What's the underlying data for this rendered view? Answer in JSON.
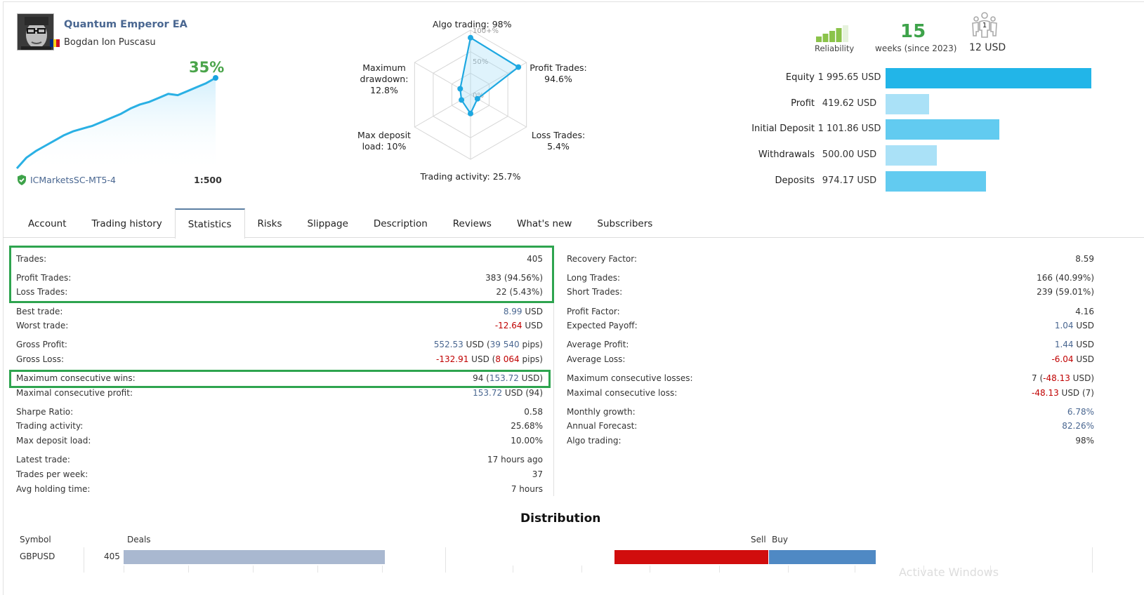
{
  "profile": {
    "signal_name": "Quantum Emperor EA",
    "author": "Bogdan Ion Puscasu",
    "flag_colors": [
      "#002B7F",
      "#FCD116",
      "#CE1126"
    ],
    "growth": "35%",
    "broker": "ICMarketsSC-MT5-4",
    "leverage": "1:500",
    "growth_curve": [
      0,
      8,
      13,
      17,
      21,
      25,
      28,
      30,
      32,
      35,
      38,
      41,
      45,
      48,
      50,
      53,
      56,
      55,
      58,
      61,
      64,
      68
    ]
  },
  "radar": {
    "axes": [
      {
        "label": "Algo trading: 98%",
        "value": 98
      },
      {
        "label": "Profit Trades:\n94.6%",
        "value": 94.6
      },
      {
        "label": "Loss Trades:\n5.4%",
        "value": 5.4
      },
      {
        "label": "Trading activity: 25.7%",
        "value": 25.7
      },
      {
        "label": "Max deposit\nload: 10%",
        "value": 10
      },
      {
        "label": "Maximum\ndrawdown:\n12.8%",
        "value": 12.8
      }
    ],
    "ring_labels": [
      "100+%",
      "50%",
      "0%"
    ]
  },
  "summary": {
    "reliability_label": "Reliability",
    "reliability_level": 4,
    "reliability_max": 5,
    "weeks": "15",
    "weeks_label": "weeks (since 2023)",
    "subscribers_count": "1",
    "price": "12 USD"
  },
  "financials": [
    {
      "label": "Equity",
      "value": "1 995.65 USD",
      "amount": 1995.65,
      "color": "#22b5e8"
    },
    {
      "label": "Profit",
      "value": "419.62 USD",
      "amount": 419.62,
      "color": "#aae1f7"
    },
    {
      "label": "Initial Deposit",
      "value": "1 101.86 USD",
      "amount": 1101.86,
      "color": "#62cbf0"
    },
    {
      "label": "Withdrawals",
      "value": "500.00 USD",
      "amount": 500.0,
      "color": "#aae1f7"
    },
    {
      "label": "Deposits",
      "value": "974.17 USD",
      "amount": 974.17,
      "color": "#62cbf0"
    }
  ],
  "tabs": [
    {
      "label": "Account",
      "active": false
    },
    {
      "label": "Trading history",
      "active": false
    },
    {
      "label": "Statistics",
      "active": true
    },
    {
      "label": "Risks",
      "active": false
    },
    {
      "label": "Slippage",
      "active": false
    },
    {
      "label": "Description",
      "active": false
    },
    {
      "label": "Reviews",
      "active": false
    },
    {
      "label": "What's new",
      "active": false
    },
    {
      "label": "Subscribers",
      "active": false
    }
  ],
  "stats_left": [
    {
      "label": "Trades:",
      "value": "405"
    },
    {
      "label": "Profit Trades:",
      "value": "383 (94.56%)"
    },
    {
      "label": "Loss Trades:",
      "value": "22 (5.43%)"
    },
    {
      "label": "Best trade:",
      "value_num": "8.99",
      "value_unit": " USD",
      "tone": "blue"
    },
    {
      "label": "Worst trade:",
      "value_num": "-12.64",
      "value_unit": " USD",
      "tone": "red"
    },
    {
      "label": "Gross Profit:",
      "value_num": "552.53",
      "value_unit": " USD (",
      "value_num2": "39 540",
      "value_unit2": " pips)",
      "tone": "blue"
    },
    {
      "label": "Gross Loss:",
      "value_num": "-132.91",
      "value_unit": " USD (",
      "value_num2": "8 064",
      "value_unit2": " pips)",
      "tone": "red"
    },
    {
      "label": "Maximum consecutive wins:",
      "value_pre": "94 (",
      "value_num": "153.72",
      "value_unit": " USD)",
      "tone": "blue"
    },
    {
      "label": "Maximal consecutive profit:",
      "value_num": "153.72",
      "value_unit": " USD (94)",
      "tone": "blue"
    },
    {
      "label": "Sharpe Ratio:",
      "value": "0.58"
    },
    {
      "label": "Trading activity:",
      "value": "25.68%"
    },
    {
      "label": "Max deposit load:",
      "value": "10.00%"
    },
    {
      "label": "Latest trade:",
      "value": "17 hours ago"
    },
    {
      "label": "Trades per week:",
      "value": "37"
    },
    {
      "label": "Avg holding time:",
      "value": "7 hours"
    }
  ],
  "stats_right": [
    {
      "label": "Recovery Factor:",
      "value": "8.59"
    },
    {
      "label": "Long Trades:",
      "value": "166 (40.99%)"
    },
    {
      "label": "Short Trades:",
      "value": "239 (59.01%)"
    },
    {
      "label": "Profit Factor:",
      "value": "4.16"
    },
    {
      "label": "Expected Payoff:",
      "value_num": "1.04",
      "value_unit": " USD",
      "tone": "blue"
    },
    {
      "label": "Average Profit:",
      "value_num": "1.44",
      "value_unit": " USD",
      "tone": "blue"
    },
    {
      "label": "Average Loss:",
      "value_num": "-6.04",
      "value_unit": " USD",
      "tone": "red"
    },
    {
      "label": "Maximum consecutive losses:",
      "value_pre": "7 (",
      "value_num": "-48.13",
      "value_unit": " USD)",
      "tone": "red"
    },
    {
      "label": "Maximal consecutive loss:",
      "value_num": "-48.13",
      "value_unit": " USD (7)",
      "tone": "red"
    },
    {
      "label": "Monthly growth:",
      "value_num": "6.78%",
      "value_unit": "",
      "tone": "blue"
    },
    {
      "label": "Annual Forecast:",
      "value_num": "82.26%",
      "value_unit": "",
      "tone": "blue"
    },
    {
      "label": "Algo trading:",
      "value": "98%"
    }
  ],
  "distribution": {
    "title": "Distribution",
    "symbol_header": "Symbol",
    "deals_header": "Deals",
    "sell_label": "Sell",
    "buy_label": "Buy",
    "rows": [
      {
        "symbol": "GBPUSD",
        "deals": "405",
        "deals_value": 405,
        "sell": 239,
        "buy": 166
      }
    ]
  },
  "watermark": "Activate Windows"
}
